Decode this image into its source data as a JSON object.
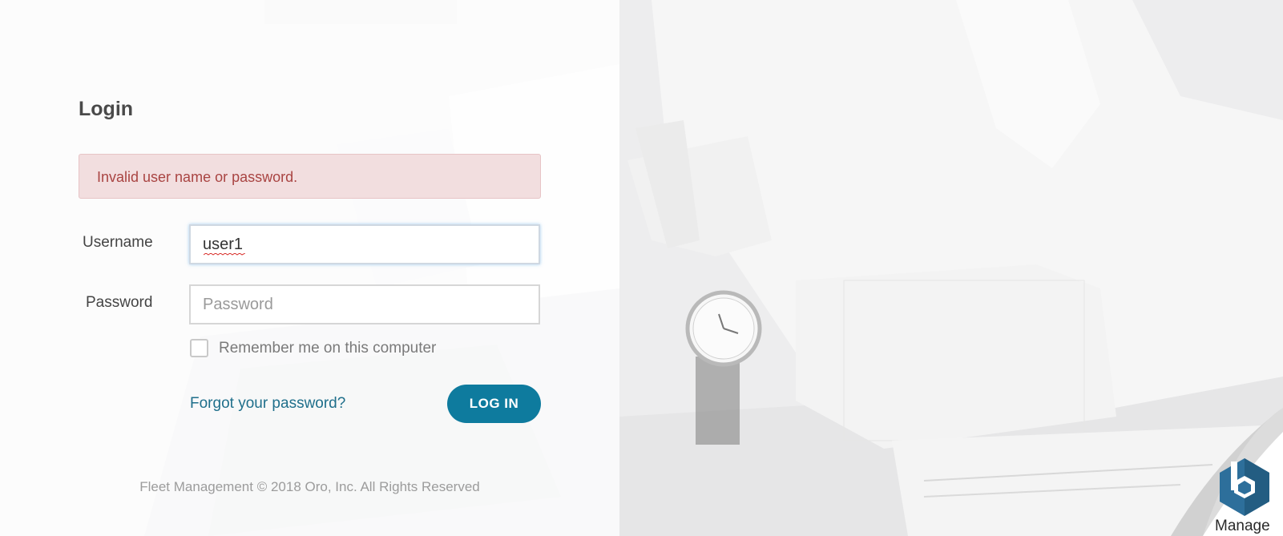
{
  "login": {
    "title": "Login",
    "error_message": "Invalid user name or password.",
    "username_label": "Username",
    "username_value": "user1",
    "password_label": "Password",
    "password_placeholder": "Password",
    "remember_label": "Remember me on this computer",
    "remember_checked": false,
    "forgot_link": "Forgot your password?",
    "login_button": "LOG IN"
  },
  "footer": {
    "text": "Fleet Management © 2018 Oro, Inc. All Rights Reserved"
  },
  "brand": {
    "label": "Manage",
    "icon": "hexagon-b-logo-icon"
  },
  "colors": {
    "accent": "#0e7b9e",
    "link": "#1f6f8b",
    "error_bg": "#f2dedf",
    "error_text": "#a94442",
    "logo": "#2d6f9b"
  }
}
